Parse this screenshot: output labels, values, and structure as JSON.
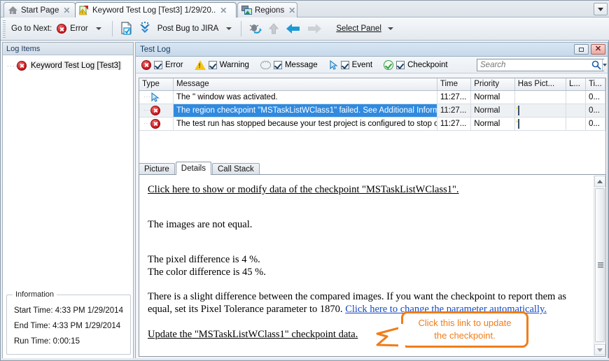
{
  "tabs": [
    {
      "label": "Start Page",
      "icon": "home-icon",
      "active": false,
      "close": "✕"
    },
    {
      "label": "Keyword Test Log [Test3]  1/29/20..",
      "icon": "keyword-test-log-icon",
      "active": true,
      "close": "✕"
    },
    {
      "label": "Regions",
      "icon": "regions-icon",
      "active": false,
      "close": "✕"
    }
  ],
  "toolbar": {
    "go_to_next_label": "Go to Next:",
    "error_label": "Error",
    "post_bug_label": "Post Bug to JIRA",
    "select_panel_label": "Select Panel",
    "icons": {
      "error": "error-icon",
      "export_log": "export-log-icon",
      "jira": "jira-icon",
      "bug_go": "bug-go-icon",
      "up_arrow": "up-arrow-icon",
      "back_arrow": "back-arrow-icon",
      "forward_arrow": "forward-arrow-icon"
    }
  },
  "left_panel": {
    "caption": "Log Items",
    "tree_root": "Keyword Test Log [Test3]",
    "information": {
      "legend": "Information",
      "start_time": "Start Time: 4:33 PM 1/29/2014",
      "end_time": "End Time: 4:33 PM 1/29/2014",
      "run_time": "Run Time: 0:00:15"
    }
  },
  "right_panel": {
    "caption": "Test Log",
    "filters": [
      {
        "label": "Error",
        "icon": "error-icon",
        "checked": true
      },
      {
        "label": "Warning",
        "icon": "warning-icon",
        "checked": true
      },
      {
        "label": "Message",
        "icon": "message-icon",
        "checked": true
      },
      {
        "label": "Event",
        "icon": "event-icon",
        "checked": true
      },
      {
        "label": "Checkpoint",
        "icon": "checkpoint-icon",
        "checked": true
      }
    ],
    "search": {
      "placeholder": "Search",
      "value": ""
    },
    "grid": {
      "columns": [
        "Type",
        "Message",
        "Time",
        "Priority",
        "Has Pict...",
        "L...",
        "Ti..."
      ],
      "rows": [
        {
          "type_icon": "event-icon",
          "message": "The \" window was activated.",
          "time": "11:27...",
          "priority": "Normal",
          "has_picture": false,
          "link": "",
          "ti": "0...",
          "selected": false
        },
        {
          "type_icon": "error-icon",
          "message": "The region checkpoint \"MSTaskListWClass1\" failed. See Additional Information for det...",
          "time": "11:27...",
          "priority": "Normal",
          "has_picture": true,
          "link": "",
          "ti": "0...",
          "selected": true
        },
        {
          "type_icon": "error-icon",
          "message": "The test run has stopped because your test project is configured to stop on errors.",
          "time": "11:27...",
          "priority": "Normal",
          "has_picture": true,
          "link": "",
          "ti": "0...",
          "selected": false
        }
      ]
    },
    "subtabs": [
      {
        "label": "Picture",
        "active": false
      },
      {
        "label": "Details",
        "active": true
      },
      {
        "label": "Call Stack",
        "active": false
      }
    ],
    "details": {
      "link_modify": "Click here to show or modify data of the checkpoint \"MSTaskListWClass1\".",
      "images_not_equal": "The images are not equal.",
      "pixel_difference": "The pixel difference is 4 %.",
      "color_difference": "The color difference is 45 %.",
      "paragraph_line1": "There is a slight difference between the compared images. If you want the checkpoint to report them as",
      "paragraph_line2_prefix": "equal, set its Pixel Tolerance parameter to 1870. ",
      "link_change_param": "Click here to change the parameter automatically.",
      "link_update": "Update the \"MSTaskListWClass1\" checkpoint data."
    }
  },
  "callout": {
    "line1": "Click this link to update",
    "line2": "the checkpoint.",
    "color": "#F07D1A"
  },
  "colors": {
    "selection_blue": "#2F8AE0",
    "link_blue": "#1449C4",
    "error_red": "#C9151B",
    "warning_yellow": "#F5C518",
    "checkpoint_green": "#2E9E3E",
    "caption_blue": "#13395E"
  }
}
